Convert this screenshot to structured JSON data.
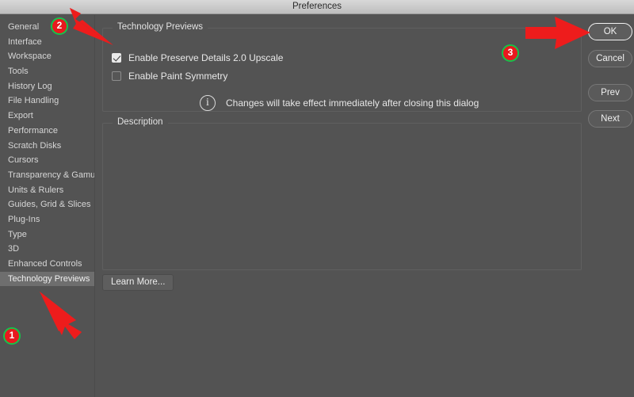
{
  "window": {
    "title": "Preferences"
  },
  "sidebar": {
    "items": [
      {
        "label": "General",
        "selected": false
      },
      {
        "label": "Interface",
        "selected": false
      },
      {
        "label": "Workspace",
        "selected": false
      },
      {
        "label": "Tools",
        "selected": false
      },
      {
        "label": "History Log",
        "selected": false
      },
      {
        "label": "File Handling",
        "selected": false
      },
      {
        "label": "Export",
        "selected": false
      },
      {
        "label": "Performance",
        "selected": false
      },
      {
        "label": "Scratch Disks",
        "selected": false
      },
      {
        "label": "Cursors",
        "selected": false
      },
      {
        "label": "Transparency & Gamut",
        "selected": false
      },
      {
        "label": "Units & Rulers",
        "selected": false
      },
      {
        "label": "Guides, Grid & Slices",
        "selected": false
      },
      {
        "label": "Plug-Ins",
        "selected": false
      },
      {
        "label": "Type",
        "selected": false
      },
      {
        "label": "3D",
        "selected": false
      },
      {
        "label": "Enhanced Controls",
        "selected": false
      },
      {
        "label": "Technology Previews",
        "selected": true
      }
    ]
  },
  "main": {
    "tech_previews": {
      "group_title": "Technology Previews",
      "options": [
        {
          "label": "Enable Preserve Details 2.0 Upscale",
          "checked": true
        },
        {
          "label": "Enable Paint Symmetry",
          "checked": false
        }
      ],
      "info_icon": "info-circle-icon",
      "info_text": "Changes will take effect immediately after closing this dialog"
    },
    "description": {
      "group_title": "Description",
      "body": ""
    },
    "learn_more_label": "Learn More..."
  },
  "buttons": {
    "ok": "OK",
    "cancel": "Cancel",
    "prev": "Prev",
    "next": "Next"
  },
  "annotations": {
    "badges": [
      {
        "number": "1"
      },
      {
        "number": "2"
      },
      {
        "number": "3"
      }
    ],
    "colors": {
      "badge_fill": "#e8191e",
      "badge_ring": "#15c44a",
      "arrow": "#ee1c1c"
    }
  }
}
